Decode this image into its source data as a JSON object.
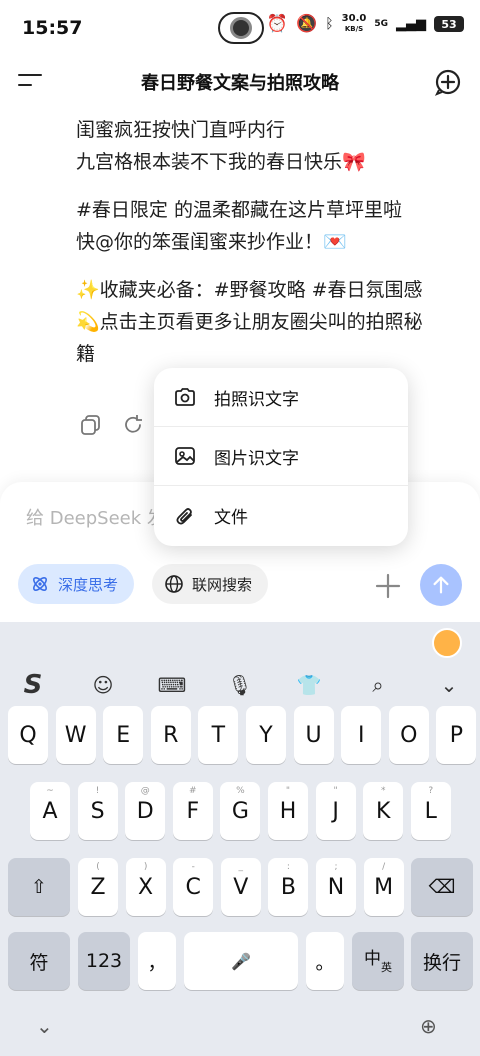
{
  "status_bar": {
    "time": "15:57",
    "net_speed": "30.0",
    "net_unit": "KB/S",
    "signal": "5G",
    "battery": "53"
  },
  "header": {
    "title": "春日野餐文案与拍照攻略"
  },
  "chat": {
    "paragraphs": [
      [
        "闺蜜疯狂按快门直呼内行",
        "九宫格根本装不下我的春日快乐🎀"
      ],
      [
        "#春日限定 的温柔都藏在这片草坪里啦",
        "快@你的笨蛋闺蜜来抄作业！💌"
      ],
      [
        "✨收藏夹必备：#野餐攻略 #春日氛围感",
        "💫点击主页看更多让朋友圈尖叫的拍照秘",
        "籍"
      ]
    ]
  },
  "popup": {
    "items": [
      {
        "label": "拍照识文字",
        "icon": "camera-icon"
      },
      {
        "label": "图片识文字",
        "icon": "image-icon"
      },
      {
        "label": "文件",
        "icon": "paperclip-icon"
      }
    ]
  },
  "composer": {
    "placeholder": "给 DeepSeek 发",
    "deep_think_label": "深度思考",
    "web_search_label": "联网搜索",
    "accent_color": "#3a6ee8",
    "send_color": "#a9c3ff"
  },
  "keyboard": {
    "row1": [
      {
        "k": "Q",
        "s": ""
      },
      {
        "k": "W",
        "s": ""
      },
      {
        "k": "E",
        "s": ""
      },
      {
        "k": "R",
        "s": ""
      },
      {
        "k": "T",
        "s": ""
      },
      {
        "k": "Y",
        "s": ""
      },
      {
        "k": "U",
        "s": ""
      },
      {
        "k": "I",
        "s": ""
      },
      {
        "k": "O",
        "s": ""
      },
      {
        "k": "P",
        "s": ""
      }
    ],
    "row2": [
      {
        "k": "A",
        "s": "~"
      },
      {
        "k": "S",
        "s": "!"
      },
      {
        "k": "D",
        "s": "@"
      },
      {
        "k": "F",
        "s": "#"
      },
      {
        "k": "G",
        "s": "%"
      },
      {
        "k": "H",
        "s": "\""
      },
      {
        "k": "J",
        "s": "\""
      },
      {
        "k": "K",
        "s": "*"
      },
      {
        "k": "L",
        "s": "?"
      }
    ],
    "row3": [
      {
        "k": "Z",
        "s": "("
      },
      {
        "k": "X",
        "s": ")"
      },
      {
        "k": "C",
        "s": "-"
      },
      {
        "k": "V",
        "s": "_"
      },
      {
        "k": "B",
        "s": ":"
      },
      {
        "k": "N",
        "s": ";"
      },
      {
        "k": "M",
        "s": "/"
      }
    ],
    "symbol_key": "符",
    "num_key": "123",
    "comma_key": "，",
    "period_key": "。",
    "lang_key_main": "中",
    "lang_key_sub": "英",
    "enter_key": "换行"
  }
}
